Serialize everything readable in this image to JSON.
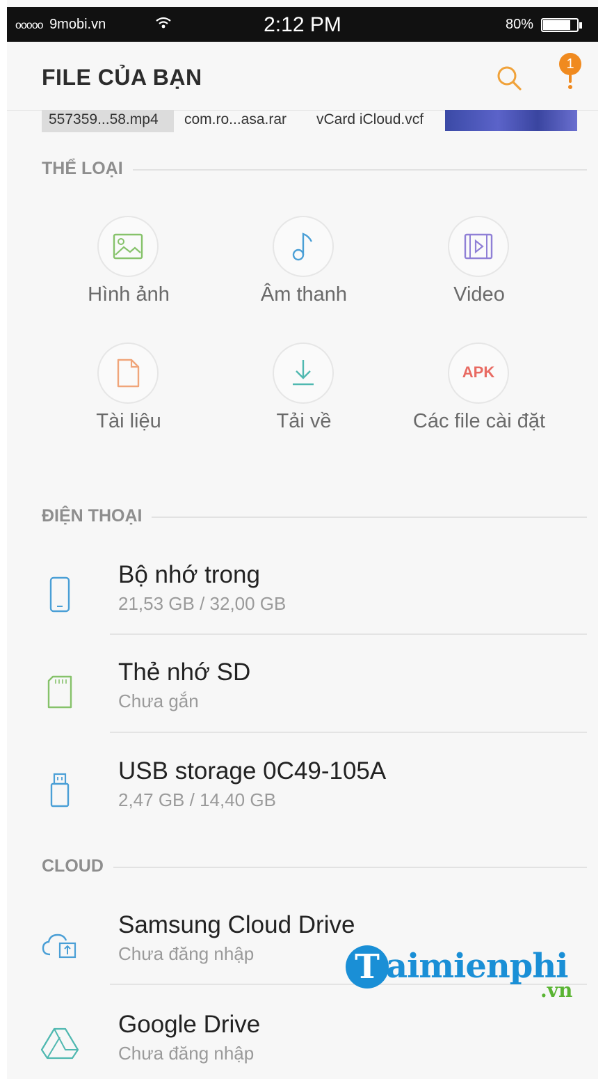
{
  "status_bar": {
    "carrier_dots": "ooooo",
    "carrier": "9mobi.vn",
    "time": "2:12 PM",
    "battery": "80%"
  },
  "header": {
    "title": "FILE CỦA BẠN",
    "notification_count": "1"
  },
  "recent": {
    "items": [
      "557359...58.mp4",
      "com.ro...asa.rar",
      "vCard iCloud.vcf"
    ]
  },
  "categories_section": {
    "label": "THỂ LOẠI",
    "items": [
      {
        "label": "Hình ảnh",
        "icon": "image-icon"
      },
      {
        "label": "Âm thanh",
        "icon": "music-note-icon"
      },
      {
        "label": "Video",
        "icon": "video-icon"
      },
      {
        "label": "Tài liệu",
        "icon": "document-icon"
      },
      {
        "label": "Tải về",
        "icon": "download-icon"
      },
      {
        "label": "Các file cài đặt",
        "icon": "apk-icon",
        "icon_text": "APK"
      }
    ]
  },
  "phone_section": {
    "label": "ĐIỆN THOẠI",
    "items": [
      {
        "title": "Bộ nhớ trong",
        "subtitle": "21,53 GB / 32,00 GB",
        "icon": "phone-icon"
      },
      {
        "title": "Thẻ nhớ SD",
        "subtitle": "Chưa gắn",
        "icon": "sd-card-icon"
      },
      {
        "title": "USB storage 0C49-105A",
        "subtitle": "2,47 GB / 14,40 GB",
        "icon": "usb-icon"
      }
    ]
  },
  "cloud_section": {
    "label": "CLOUD",
    "items": [
      {
        "title": "Samsung Cloud Drive",
        "subtitle": "Chưa đăng nhập",
        "icon": "cloud-icon"
      },
      {
        "title": "Google Drive",
        "subtitle": "Chưa đăng nhập",
        "icon": "google-drive-icon"
      }
    ]
  },
  "watermark": {
    "initial": "T",
    "text": "aimienphi",
    "suffix": ".vn"
  },
  "colors": {
    "accent_orange": "#f08a1f",
    "icon_blue": "#4a9fd6",
    "icon_green": "#86c26a",
    "icon_purple": "#8f7fd6",
    "icon_peach": "#f0a57a",
    "icon_teal": "#4fb8b0",
    "icon_red": "#e86a62"
  }
}
